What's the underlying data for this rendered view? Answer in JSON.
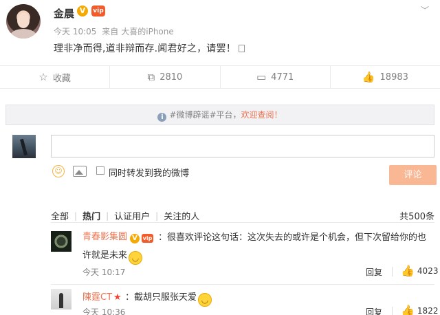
{
  "post": {
    "author": "金晨",
    "verified_badge": "V",
    "member_badge": "vip",
    "time": "今天 10:05",
    "source_prefix": "来自",
    "source": "大喜的iPhone",
    "text": "理非净而得,道非辩而存.闻君好之，请罢！"
  },
  "actions": {
    "favorite_label": "收藏",
    "repost_count": "2810",
    "comment_count": "4771",
    "like_count": "18983"
  },
  "notice": {
    "icon": "i",
    "text": "#微博辟谣#平台，",
    "link": "欢迎查阅！"
  },
  "composer": {
    "input_placeholder": "",
    "forward_label": "同时转发到我的微博",
    "submit_label": "评论"
  },
  "tabs": {
    "items": [
      "全部",
      "热门",
      "认证用户",
      "关注的人"
    ],
    "total": "共500条"
  },
  "comments": [
    {
      "name": "青春影集圆",
      "text_line1": "：很喜欢评论这句话：这次失去的或许是个机会，但下次留给你的也",
      "text_line2": "许就是未来",
      "time": "今天 10:17",
      "reply": "回复",
      "likes": "4023"
    },
    {
      "name": "陳霆CT",
      "text_line1": "：截胡只服张天爱",
      "time": "今天 10:36",
      "reply": "回复",
      "likes": "1822"
    }
  ],
  "colors": {
    "accent": "#eb7350",
    "verified": "#f6a900",
    "submit_disabled": "#f9b793"
  },
  "icons": [
    "chevron-down-icon",
    "star-outline-icon",
    "repost-icon",
    "comment-icon",
    "thumb-up-icon",
    "info-icon",
    "emoji-icon",
    "image-icon"
  ]
}
